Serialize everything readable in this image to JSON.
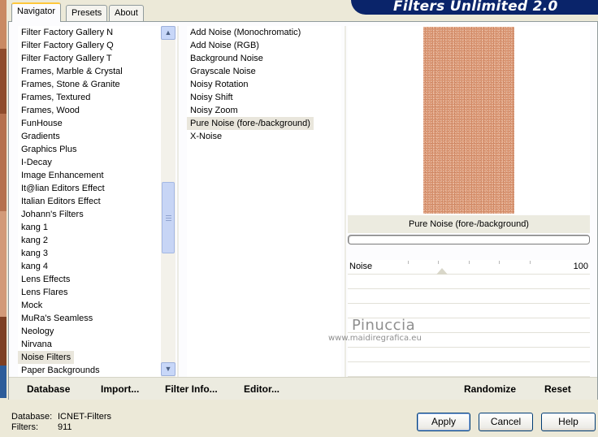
{
  "window": {
    "title": "Filters Unlimited 2.0"
  },
  "tabs": [
    {
      "label": "Navigator",
      "active": true
    },
    {
      "label": "Presets",
      "active": false
    },
    {
      "label": "About",
      "active": false
    }
  ],
  "categories": {
    "items": [
      "Filter Factory Gallery N",
      "Filter Factory Gallery Q",
      "Filter Factory Gallery T",
      "Frames, Marble & Crystal",
      "Frames, Stone & Granite",
      "Frames, Textured",
      "Frames, Wood",
      "FunHouse",
      "Gradients",
      "Graphics Plus",
      "I-Decay",
      "Image Enhancement",
      "It@lian Editors Effect",
      "Italian Editors Effect",
      "Johann's Filters",
      "kang 1",
      "kang 2",
      "kang 3",
      "kang 4",
      "Lens Effects",
      "Lens Flares",
      "Mock",
      "MuRa's Seamless",
      "Neology",
      "Nirvana",
      "Noise Filters",
      "Paper Backgrounds"
    ],
    "selected": "Noise Filters"
  },
  "filters": {
    "items": [
      "Add Noise (Monochromatic)",
      "Add Noise (RGB)",
      "Background Noise",
      "Grayscale Noise",
      "Noisy Rotation",
      "Noisy Shift",
      "Noisy Zoom",
      "Pure Noise (fore-/background)",
      "X-Noise"
    ],
    "selected": "Pure Noise (fore-/background)"
  },
  "preview": {
    "filter_name": "Pure Noise (fore-/background)",
    "color": "#d9936f"
  },
  "params": {
    "noise_label": "Noise",
    "noise_value": "100"
  },
  "watermark": {
    "name": "Pinuccia",
    "url": "www.maidiregrafica.eu"
  },
  "actions": {
    "database": "Database",
    "import": "Import...",
    "filter_info": "Filter Info...",
    "editor": "Editor...",
    "randomize": "Randomize",
    "reset": "Reset"
  },
  "status": {
    "database_label": "Database:",
    "database_value": "ICNET-Filters",
    "filters_label": "Filters:",
    "filters_value": "911"
  },
  "buttons": {
    "apply": "Apply",
    "cancel": "Cancel",
    "help": "Help"
  },
  "colors": {
    "banner": "#0a246a",
    "accent_tab": "#ffc83c",
    "selection": "#e9e6dc"
  }
}
